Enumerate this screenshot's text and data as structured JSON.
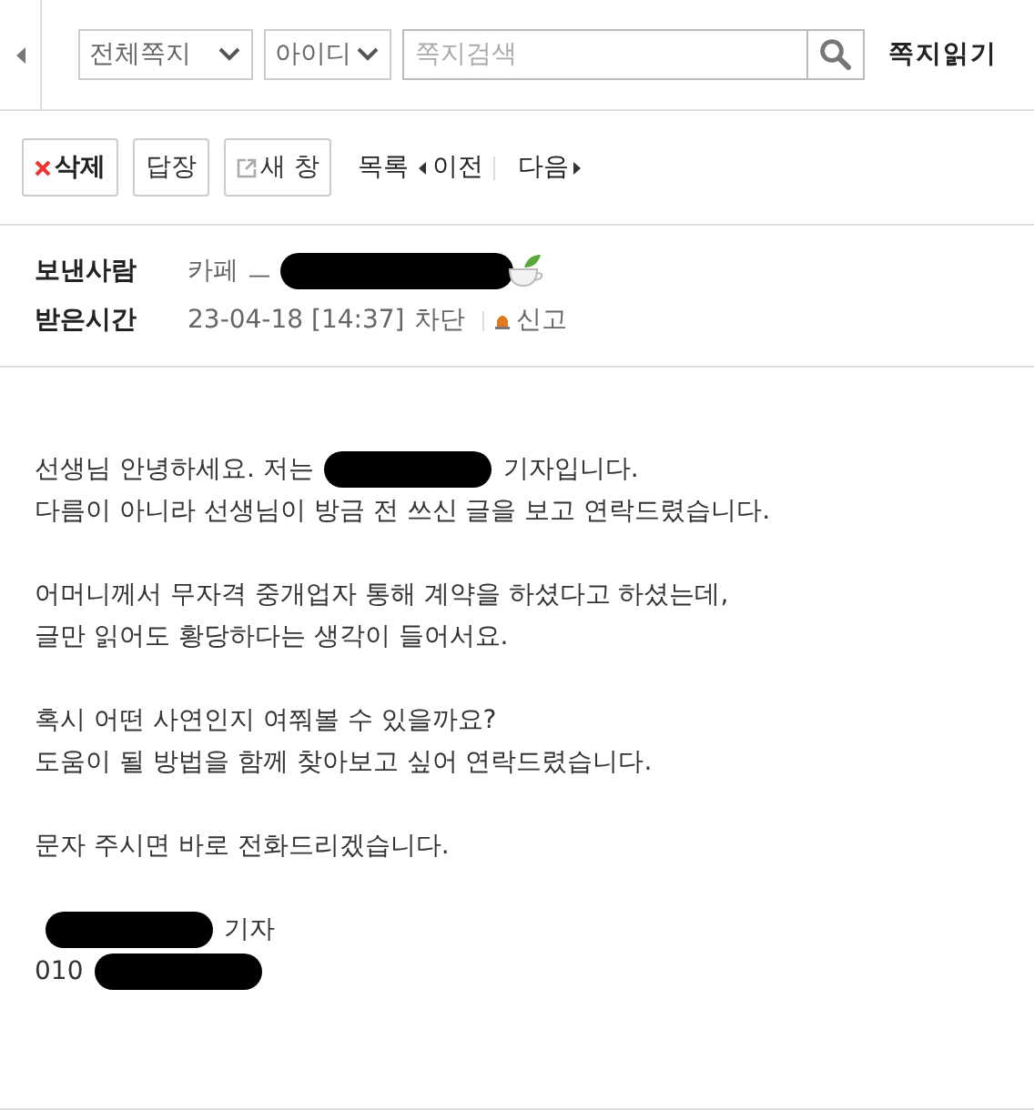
{
  "toolbar": {
    "folder_select": "전체쪽지",
    "field_select": "아이디",
    "search": {
      "placeholder": "쪽지검색"
    },
    "title": "쪽지읽기"
  },
  "actions": [
    {
      "label": "삭제",
      "kind": "delete"
    },
    {
      "label": "답장",
      "kind": "plain"
    },
    {
      "label": "새 창",
      "kind": "newwindow"
    }
  ],
  "nav": {
    "list": "목록",
    "prev": "이전",
    "next": "다음"
  },
  "meta": {
    "sender_label": "보낸사람",
    "sender_prefix": "카페 ㅡ",
    "time_label": "받은시간",
    "time": "23-04-18 [14:37]",
    "block": "차단",
    "report": "신고"
  },
  "body": [
    {
      "lines": [
        [
          {
            "kind": "text",
            "text": "선생님 안녕하세요. 저는"
          },
          {
            "kind": "redaction"
          },
          {
            "kind": "text",
            "text": "기자입니다."
          }
        ],
        [
          {
            "kind": "text",
            "text": "다름이 아니라 선생님이 방금 전 쓰신 글을 보고 연락드렸습니다."
          }
        ]
      ]
    },
    {
      "lines": [
        [
          {
            "kind": "text",
            "text": "어머니께서 무자격 중개업자 통해 계약을 하셨다고 하셨는데,"
          }
        ],
        [
          {
            "kind": "text",
            "text": "글만 읽어도 황당하다는 생각이 들어서요."
          }
        ]
      ]
    },
    {
      "lines": [
        [
          {
            "kind": "text",
            "text": "혹시 어떤 사연인지 여쭤볼 수 있을까요?"
          }
        ],
        [
          {
            "kind": "text",
            "text": "도움이 될 방법을 함께 찾아보고 싶어 연락드렸습니다."
          }
        ]
      ]
    },
    {
      "lines": [
        [
          {
            "kind": "text",
            "text": "문자 주시면 바로 전화드리겠습니다."
          }
        ]
      ]
    },
    {
      "lines": [
        [
          {
            "kind": "redaction"
          },
          {
            "kind": "text",
            "text": "기자"
          }
        ],
        [
          {
            "kind": "text",
            "text": "010"
          },
          {
            "kind": "redaction"
          }
        ]
      ]
    }
  ]
}
